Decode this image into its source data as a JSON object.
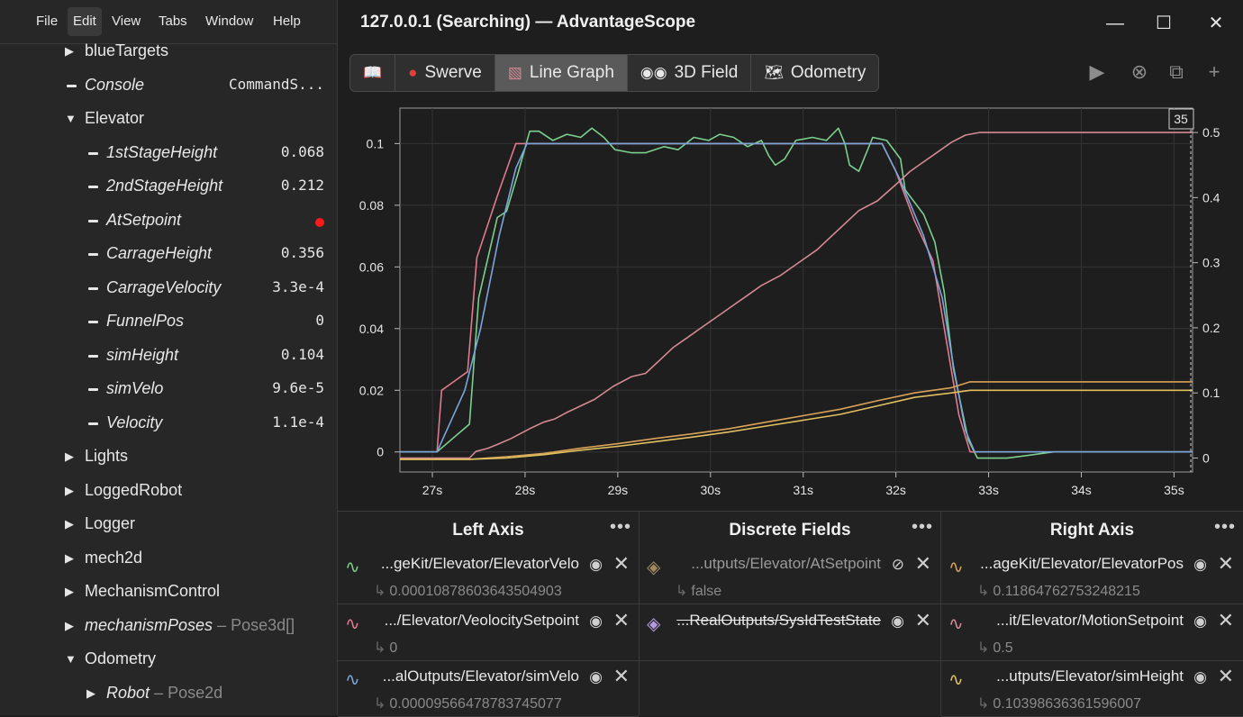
{
  "menu": [
    "File",
    "Edit",
    "View",
    "Tabs",
    "Window",
    "Help"
  ],
  "tree": [
    {
      "type": "folder",
      "open": false,
      "label": "blueTargets",
      "indent": 0
    },
    {
      "type": "leaf",
      "label": "Console",
      "indent": 0,
      "italic": true,
      "value": "CommandS..."
    },
    {
      "type": "folder",
      "open": true,
      "label": "Elevator",
      "indent": 0
    },
    {
      "type": "leaf",
      "label": "1stStageHeight",
      "indent": 1,
      "italic": true,
      "value": "0.068"
    },
    {
      "type": "leaf",
      "label": "2ndStageHeight",
      "indent": 1,
      "italic": true,
      "value": "0.212"
    },
    {
      "type": "leaf",
      "label": "AtSetpoint",
      "indent": 1,
      "italic": true,
      "dot": true
    },
    {
      "type": "leaf",
      "label": "CarrageHeight",
      "indent": 1,
      "italic": true,
      "value": "0.356"
    },
    {
      "type": "leaf",
      "label": "CarrageVelocity",
      "indent": 1,
      "italic": true,
      "value": "3.3e-4"
    },
    {
      "type": "leaf",
      "label": "FunnelPos",
      "indent": 1,
      "italic": true,
      "value": "0"
    },
    {
      "type": "leaf",
      "label": "simHeight",
      "indent": 1,
      "italic": true,
      "value": "0.104"
    },
    {
      "type": "leaf",
      "label": "simVelo",
      "indent": 1,
      "italic": true,
      "value": "9.6e-5"
    },
    {
      "type": "leaf",
      "label": "Velocity",
      "indent": 1,
      "italic": true,
      "value": "1.1e-4"
    },
    {
      "type": "folder",
      "open": false,
      "label": "Lights",
      "indent": 0
    },
    {
      "type": "folder",
      "open": false,
      "label": "LoggedRobot",
      "indent": 0
    },
    {
      "type": "folder",
      "open": false,
      "label": "Logger",
      "indent": 0
    },
    {
      "type": "folder",
      "open": false,
      "label": "mech2d",
      "indent": 0
    },
    {
      "type": "folder",
      "open": false,
      "label": "MechanismControl",
      "indent": 0
    },
    {
      "type": "folder",
      "open": false,
      "label": "mechanismPoses",
      "indent": 0,
      "italic": true,
      "typeLabel": "– Pose3d[]"
    },
    {
      "type": "folder",
      "open": true,
      "label": "Odometry",
      "indent": 0
    },
    {
      "type": "folder",
      "open": false,
      "label": "Robot",
      "indent": 1,
      "italic": true,
      "typeLabel": "– Pose2d"
    }
  ],
  "title": "127.0.0.1 (Searching) — AdvantageScope",
  "tabs": [
    {
      "label": "",
      "icon": "📖",
      "name": "tab-docs"
    },
    {
      "label": "Swerve",
      "icon": "●",
      "name": "tab-swerve"
    },
    {
      "label": "Line Graph",
      "icon": "▧",
      "name": "tab-line-graph",
      "active": true
    },
    {
      "label": "3D Field",
      "icon": "◉◉",
      "name": "tab-3d-field"
    },
    {
      "label": "Odometry",
      "icon": "🗺",
      "name": "tab-odometry"
    }
  ],
  "graph": {
    "cursor_label": "35",
    "left_ticks": [
      "0",
      "0.02",
      "0.04",
      "0.06",
      "0.08",
      "0.1"
    ],
    "right_ticks": [
      "0",
      "0.1",
      "0.2",
      "0.3",
      "0.4",
      "0.5"
    ],
    "x_ticks": [
      "27s",
      "28s",
      "29s",
      "30s",
      "31s",
      "32s",
      "33s",
      "34s",
      "35s"
    ]
  },
  "chart_data": {
    "type": "line",
    "x_range": [
      26.65,
      35.2
    ],
    "left_range": [
      -0.0065,
      0.1115
    ],
    "right_range": [
      -0.0215,
      0.5375
    ],
    "series": [
      {
        "axis": "left",
        "color": "#7ccf8e",
        "points": [
          [
            26.65,
            0
          ],
          [
            27.05,
            0
          ],
          [
            27.4,
            0.009
          ],
          [
            27.5,
            0.05
          ],
          [
            27.7,
            0.076
          ],
          [
            27.8,
            0.078
          ],
          [
            27.92,
            0.09
          ],
          [
            28.05,
            0.104
          ],
          [
            28.15,
            0.104
          ],
          [
            28.3,
            0.101
          ],
          [
            28.45,
            0.103
          ],
          [
            28.6,
            0.102
          ],
          [
            28.72,
            0.105
          ],
          [
            28.85,
            0.102
          ],
          [
            28.97,
            0.098
          ],
          [
            29.15,
            0.097
          ],
          [
            29.3,
            0.097
          ],
          [
            29.5,
            0.099
          ],
          [
            29.65,
            0.098
          ],
          [
            29.82,
            0.102
          ],
          [
            29.98,
            0.101
          ],
          [
            30.1,
            0.103
          ],
          [
            30.25,
            0.102
          ],
          [
            30.4,
            0.099
          ],
          [
            30.55,
            0.101
          ],
          [
            30.63,
            0.096
          ],
          [
            30.7,
            0.093
          ],
          [
            30.8,
            0.095
          ],
          [
            30.92,
            0.101
          ],
          [
            31.1,
            0.102
          ],
          [
            31.25,
            0.101
          ],
          [
            31.38,
            0.105
          ],
          [
            31.45,
            0.1
          ],
          [
            31.5,
            0.093
          ],
          [
            31.6,
            0.091
          ],
          [
            31.75,
            0.102
          ],
          [
            31.9,
            0.101
          ],
          [
            32.05,
            0.095
          ],
          [
            32.1,
            0.085
          ],
          [
            32.3,
            0.077
          ],
          [
            32.42,
            0.068
          ],
          [
            32.52,
            0.052
          ],
          [
            32.62,
            0.027
          ],
          [
            32.78,
            0.004
          ],
          [
            32.88,
            -0.002
          ],
          [
            33.2,
            -0.002
          ],
          [
            33.7,
            0
          ],
          [
            34.1,
            0
          ],
          [
            34.6,
            0
          ],
          [
            35.2,
            0
          ]
        ]
      },
      {
        "axis": "left",
        "color": "#e07a8e",
        "points": [
          [
            26.65,
            0
          ],
          [
            27.05,
            0
          ],
          [
            27.1,
            0.02
          ],
          [
            27.38,
            0.026
          ],
          [
            27.48,
            0.063
          ],
          [
            27.7,
            0.083
          ],
          [
            27.9,
            0.1
          ],
          [
            31.85,
            0.1
          ],
          [
            32,
            0.091
          ],
          [
            32.2,
            0.075
          ],
          [
            32.4,
            0.062
          ],
          [
            32.55,
            0.035
          ],
          [
            32.68,
            0.012
          ],
          [
            32.8,
            0
          ],
          [
            35.2,
            0
          ]
        ]
      },
      {
        "axis": "left",
        "color": "#7aa6dc",
        "points": [
          [
            26.65,
            0
          ],
          [
            27.05,
            0
          ],
          [
            27.35,
            0.02
          ],
          [
            27.52,
            0.04
          ],
          [
            27.72,
            0.07
          ],
          [
            27.9,
            0.092
          ],
          [
            28.02,
            0.1
          ],
          [
            31.85,
            0.1
          ],
          [
            32.05,
            0.088
          ],
          [
            32.3,
            0.07
          ],
          [
            32.5,
            0.05
          ],
          [
            32.62,
            0.028
          ],
          [
            32.75,
            0.007
          ],
          [
            32.85,
            0
          ],
          [
            35.2,
            0
          ]
        ]
      },
      {
        "axis": "right",
        "color": "#d48a96",
        "points": [
          [
            26.65,
            0
          ],
          [
            27.4,
            0
          ],
          [
            27.47,
            0.01
          ],
          [
            27.6,
            0.015
          ],
          [
            27.72,
            0.022
          ],
          [
            27.85,
            0.03
          ],
          [
            28.05,
            0.045
          ],
          [
            28.2,
            0.055
          ],
          [
            28.32,
            0.06
          ],
          [
            28.45,
            0.07
          ],
          [
            28.6,
            0.08
          ],
          [
            28.75,
            0.09
          ],
          [
            28.95,
            0.11
          ],
          [
            29.15,
            0.125
          ],
          [
            29.3,
            0.13
          ],
          [
            29.45,
            0.15
          ],
          [
            29.6,
            0.17
          ],
          [
            29.75,
            0.185
          ],
          [
            29.9,
            0.2
          ],
          [
            30.1,
            0.22
          ],
          [
            30.25,
            0.235
          ],
          [
            30.4,
            0.25
          ],
          [
            30.55,
            0.265
          ],
          [
            30.75,
            0.28
          ],
          [
            30.95,
            0.3
          ],
          [
            31.15,
            0.32
          ],
          [
            31.3,
            0.34
          ],
          [
            31.45,
            0.36
          ],
          [
            31.6,
            0.38
          ],
          [
            31.8,
            0.395
          ],
          [
            32,
            0.42
          ],
          [
            32.15,
            0.44
          ],
          [
            32.3,
            0.455
          ],
          [
            32.45,
            0.47
          ],
          [
            32.6,
            0.485
          ],
          [
            32.75,
            0.496
          ],
          [
            32.9,
            0.5
          ],
          [
            35.2,
            0.5
          ]
        ]
      },
      {
        "axis": "right",
        "color": "#d9a258",
        "points": [
          [
            26.65,
            -0.002
          ],
          [
            27.4,
            -0.002
          ],
          [
            27.8,
            0.002
          ],
          [
            28.2,
            0.007
          ],
          [
            28.6,
            0.015
          ],
          [
            29,
            0.022
          ],
          [
            29.4,
            0.03
          ],
          [
            29.8,
            0.037
          ],
          [
            30.2,
            0.045
          ],
          [
            30.6,
            0.055
          ],
          [
            31,
            0.065
          ],
          [
            31.4,
            0.075
          ],
          [
            31.8,
            0.088
          ],
          [
            32.2,
            0.1
          ],
          [
            32.6,
            0.108
          ],
          [
            32.8,
            0.117
          ],
          [
            35.2,
            0.117
          ]
        ]
      },
      {
        "axis": "right",
        "color": "#e0c060",
        "points": [
          [
            26.65,
            -0.002
          ],
          [
            27.4,
            -0.002
          ],
          [
            27.8,
            0
          ],
          [
            28.2,
            0.005
          ],
          [
            28.6,
            0.012
          ],
          [
            29,
            0.018
          ],
          [
            29.4,
            0.025
          ],
          [
            29.8,
            0.032
          ],
          [
            30.2,
            0.04
          ],
          [
            30.6,
            0.049
          ],
          [
            31,
            0.058
          ],
          [
            31.4,
            0.067
          ],
          [
            31.8,
            0.08
          ],
          [
            32.2,
            0.093
          ],
          [
            32.6,
            0.1
          ],
          [
            32.8,
            0.104
          ],
          [
            35.2,
            0.104
          ]
        ]
      }
    ]
  },
  "panels": [
    {
      "title": "Left Axis",
      "name": "left-axis-panel",
      "fields": [
        {
          "name": "...geKit/Elevator/ElevatorVelo",
          "value": "0.00010878603643504903",
          "color": "#7ccf8e"
        },
        {
          "name": ".../Elevator/VeolocitySetpoint",
          "value": "0",
          "color": "#e07a8e"
        },
        {
          "name": "...alOutputs/Elevator/simVelo",
          "value": "0.0000956647878374507​7",
          "color": "#7aa6dc"
        }
      ]
    },
    {
      "title": "Discrete Fields",
      "name": "discrete-fields-panel",
      "fields": [
        {
          "name": "...utputs/Elevator/AtSetpoint",
          "value": "false",
          "color": "#a08860",
          "dim": true,
          "hidden": true
        },
        {
          "name": "...RealOutputs/SysIdTestState",
          "value": "",
          "color": "#b49adf",
          "strike": true
        }
      ]
    },
    {
      "title": "Right Axis",
      "name": "right-axis-panel",
      "fields": [
        {
          "name": "...ageKit/Elevator/ElevatorPos",
          "value": "0.11864762753248215",
          "color": "#d9a258"
        },
        {
          "name": "...it/Elevator/MotionSetpoint",
          "value": "0.5",
          "color": "#d48a96"
        },
        {
          "name": "...utputs/Elevator/simHeight",
          "value": "0.10398636361596007",
          "color": "#e0c060"
        }
      ]
    }
  ]
}
